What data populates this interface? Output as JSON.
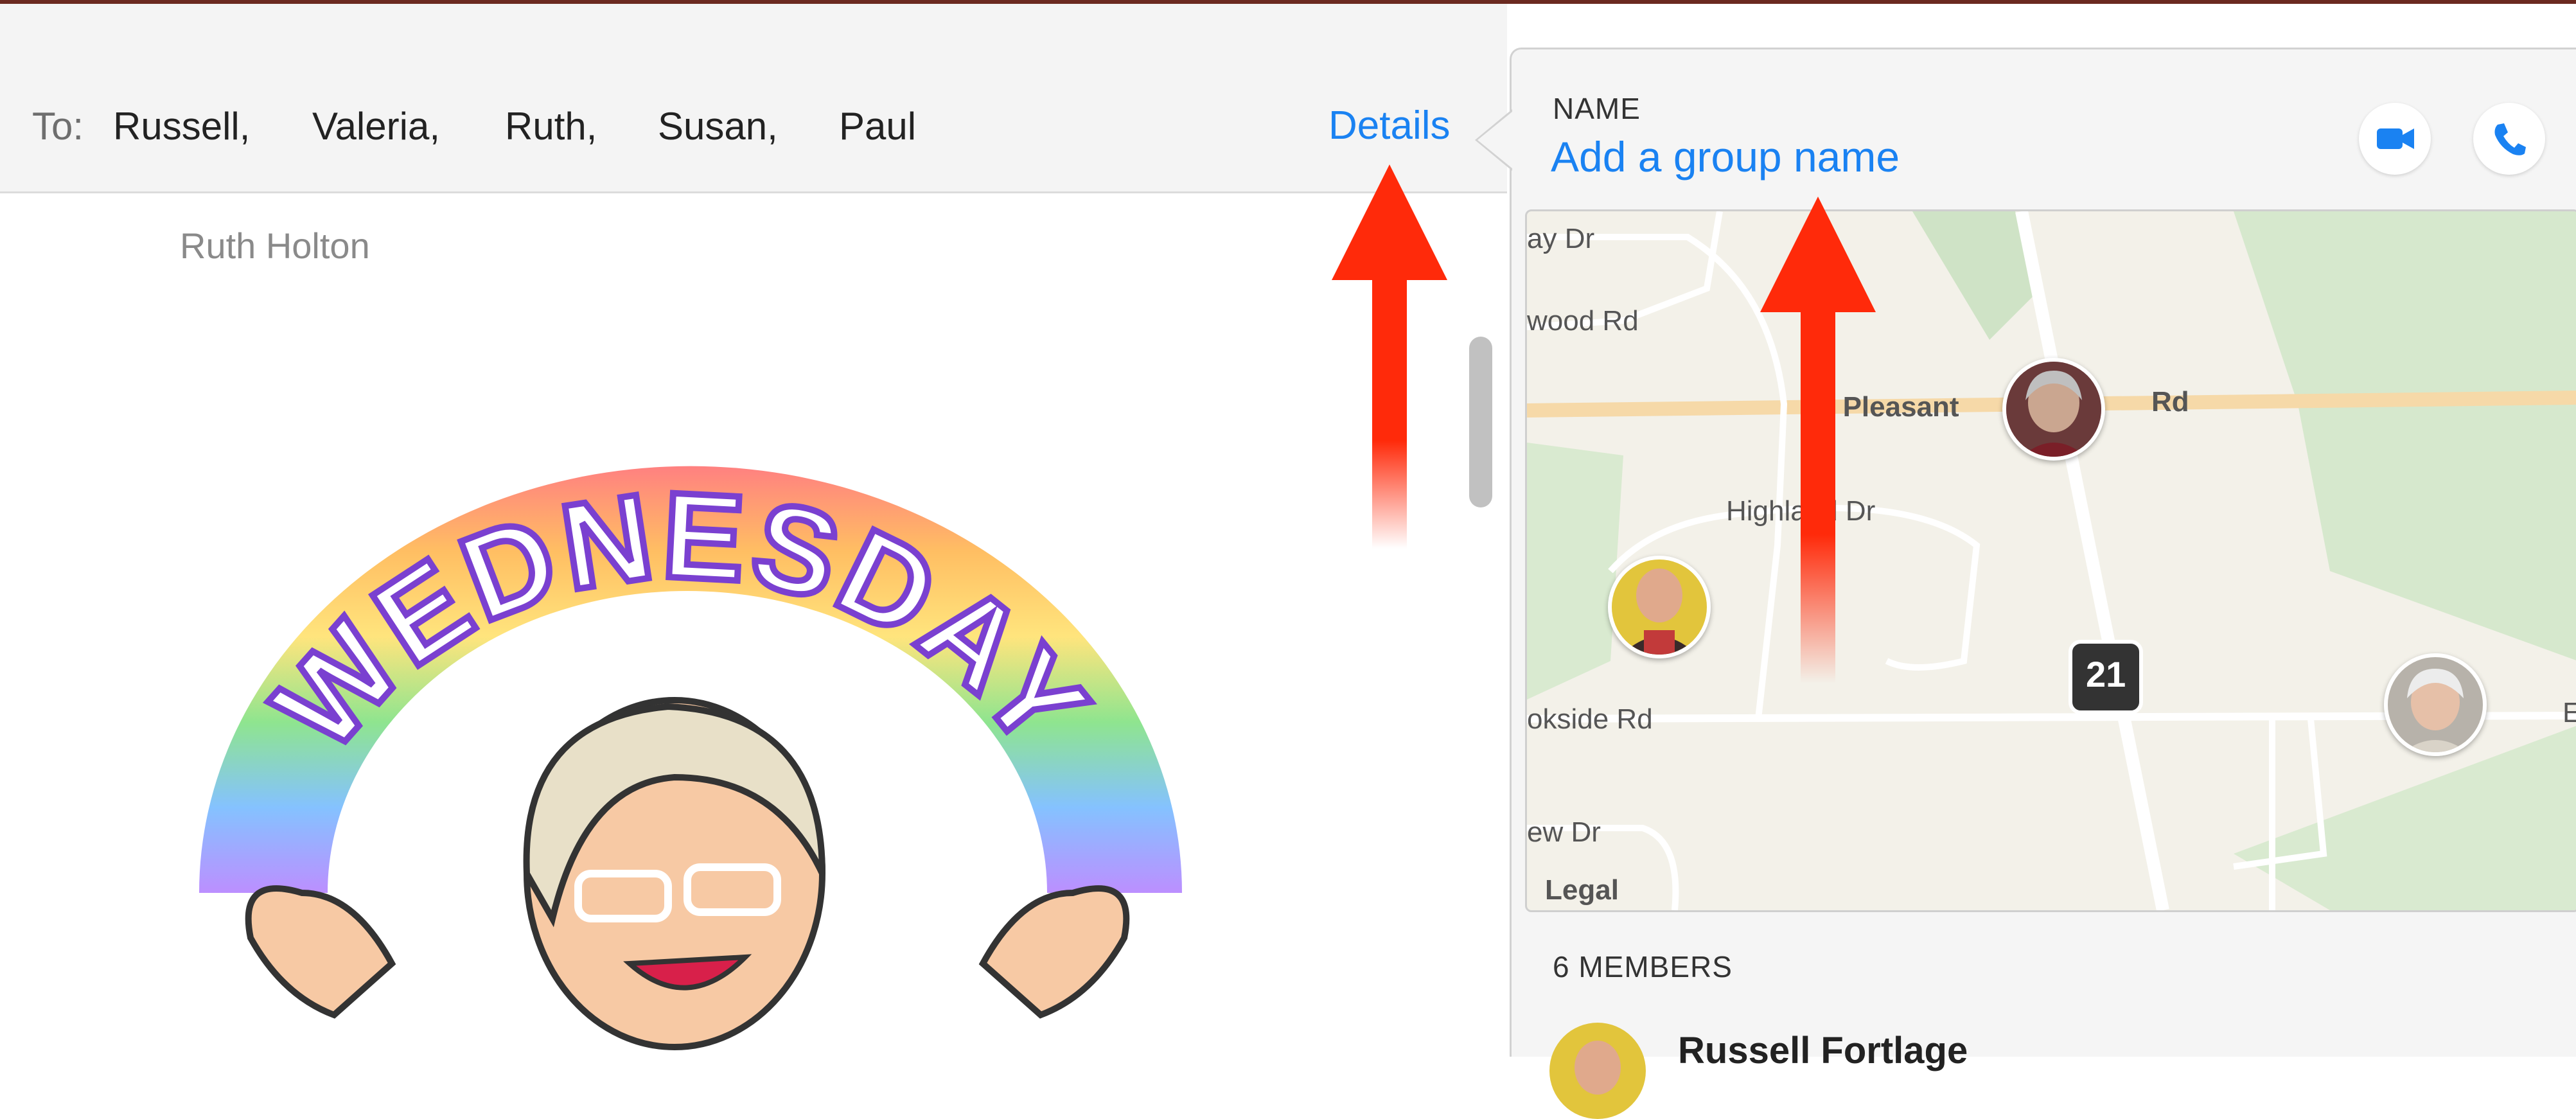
{
  "to_bar": {
    "label": "To:",
    "recipients": [
      "Russell,",
      "Valeria,",
      "Ruth,",
      "Susan,",
      "Paul"
    ],
    "details_label": "Details"
  },
  "message": {
    "sender": "Ruth Holton",
    "sticker_text": "WEDNESDAY"
  },
  "details_panel": {
    "name_caption": "NAME",
    "group_name_placeholder": "Add a group name",
    "map_labels": [
      "ay Dr",
      "wood Rd",
      "E Pleasant",
      "Rd",
      "Highland Dr",
      "okside Rd",
      "ew Dr",
      "Legal",
      "E"
    ],
    "route_shield": "21",
    "members_caption": "6 MEMBERS",
    "first_member": "Russell Fortlage"
  },
  "icons": {
    "video": "video-camera-icon",
    "phone": "phone-icon"
  },
  "colors": {
    "accent_blue": "#1a82f2",
    "annotation_red": "#ff2a0a"
  }
}
